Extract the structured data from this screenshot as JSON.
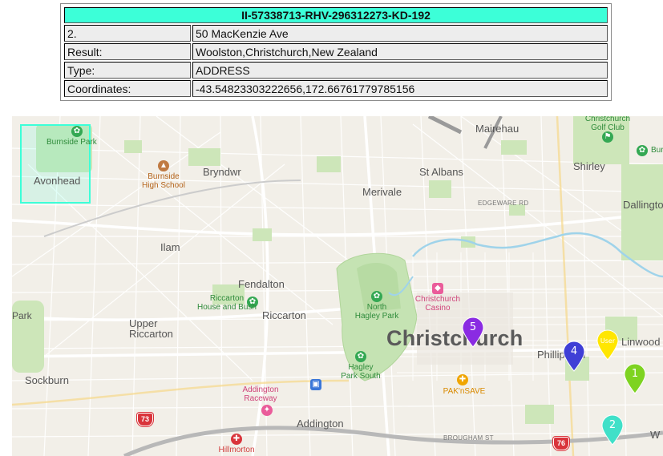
{
  "info_table": {
    "header": "II-57338713-RHV-296312273-KD-192",
    "rows": [
      {
        "label": "2.",
        "value": "50 MacKenzie Ave"
      },
      {
        "label": "Result:",
        "value": "Woolston,Christchurch,New Zealand"
      },
      {
        "label": "Type:",
        "value": "ADDRESS"
      },
      {
        "label": "Coordinates:",
        "value": "-43.54823303222656,172.66761779785156"
      }
    ]
  },
  "map": {
    "place_labels": {
      "christchurch": "Christchurch",
      "mairehau": "Mairehau",
      "st_albans": "St Albans",
      "shirley": "Shirley",
      "dallington": "Dallingto",
      "merivale": "Merivale",
      "bryndwr": "Bryndwr",
      "avonhead": "Avonhead",
      "ilam": "Ilam",
      "fendalton": "Fendalton",
      "riccarton": "Riccarton",
      "upper_riccarton": "Upper\nRiccarton",
      "sockburn": "Sockburn",
      "addington": "Addington",
      "phillipstown": "Phillip   on",
      "linwood": "Linwood",
      "park_left": "Park",
      "w_right": "W"
    },
    "poi_labels": {
      "burnside_park": "Burnside Park",
      "burnside_high": "Burnside\nHigh School",
      "riccarton_house": "Riccarton\nHouse and Bush",
      "north_hagley": "North\nHagley Park",
      "hagley_south": "Hagley\nPark South",
      "christchurch_casino": "Christchurch\nCasino",
      "golf_club": "Christchurch\nGolf Club",
      "burwood": "Bur",
      "pak_nsave": "PAK'nSAVE",
      "addington_raceway": "Addington\nRaceway",
      "hillmorton": "Hillmorton"
    },
    "street_labels": {
      "edgeware": "EDGEWARE RD",
      "brougham": "BROUGHAM ST"
    },
    "route_shields": {
      "left": "73",
      "right": "76"
    },
    "markers": [
      {
        "label": "5",
        "color": "#8a2be2"
      },
      {
        "label": "4",
        "color": "#3f3fd6"
      },
      {
        "label": "User",
        "color": "#ffe600"
      },
      {
        "label": "1",
        "color": "#7ed321"
      },
      {
        "label": "2",
        "color": "#40e0c8"
      }
    ]
  }
}
